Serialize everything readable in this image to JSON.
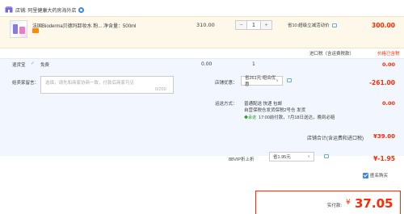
{
  "store": {
    "label": "店铺: 阿里健康大药房海外店"
  },
  "item": {
    "title": "法国Bioderma贝德玛卸妆水 粉... 净含量：500ml",
    "unit_price": "310.00",
    "qty": {
      "minus": "−",
      "value": "1",
      "plus": "+"
    },
    "promo": "省10:超级立减活动价",
    "total": "300.00"
  },
  "tax": {
    "label": "进口税（含运费税款）",
    "included": "价格已含税"
  },
  "service": {
    "name": "退货宝",
    "check": "✓",
    "free": "免费",
    "price": "0.00",
    "qty": "1",
    "total": "0.00"
  },
  "message": {
    "label": "给卖家留言：",
    "placeholder": "选填，请先和商家协商一致，付款后商家可见",
    "count": "0/200"
  },
  "coupon": {
    "label": "店铺优惠：",
    "selected": "省261元:组合优惠",
    "caret": "∨",
    "amount": "-261.00"
  },
  "shipping": {
    "label": "运送方式：",
    "line1": "普通配送 快递 包邮",
    "line2": "自营保税仓发货保税2号仓  发货",
    "tag": "◆承诺",
    "line3": "17:00前付款，7月18日送达，晚到必赔",
    "amount": "0.00"
  },
  "store_total": {
    "label": "店铺合计(含运费和进口税)",
    "amount": "¥39.00"
  },
  "vip": {
    "label": "88VIP折上折",
    "selected": "省1.95元",
    "caret": "∨",
    "amount": "¥-1.95"
  },
  "anonymous": {
    "label": "匿名购买"
  },
  "payment": {
    "label": "实付款:",
    "currency": "¥",
    "amount": "37.05"
  },
  "colors": {
    "accent_red": "#ff2a00",
    "link_blue": "#3b8ae8",
    "item_bg": "#fdf8e9",
    "panel_bg": "#f2f7ff"
  }
}
